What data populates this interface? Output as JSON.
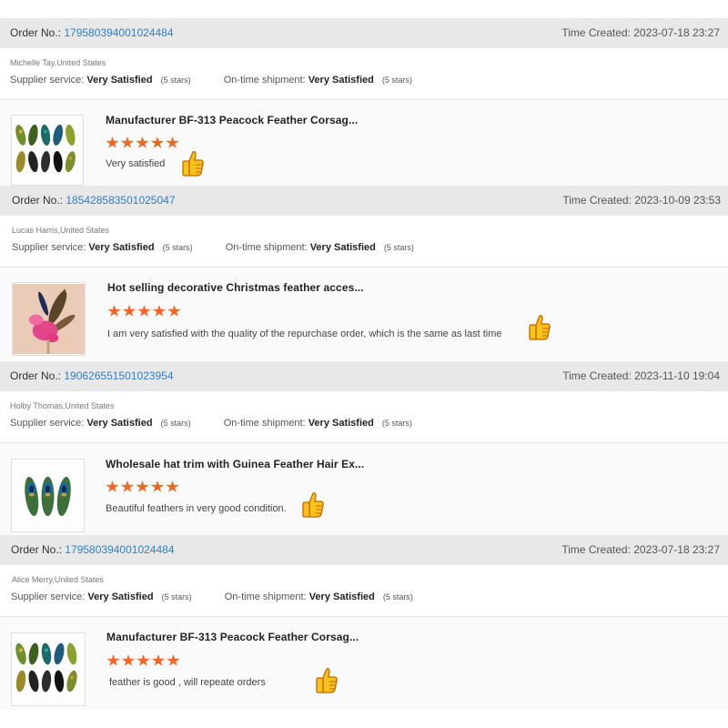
{
  "reviews": [
    {
      "order_label": "Order No.:",
      "order_no": "179580394001024484",
      "time_created": "Time Created: 2023-07-18 23:27",
      "buyer": "Michelle Tay,United States",
      "supplier_label": "Supplier service:",
      "supplier_value": "Very Satisfied",
      "supplier_stars": "(5 stars)",
      "shipment_label": "On-time shipment:",
      "shipment_value": "Very Satisfied",
      "shipment_stars": "(5 stars)",
      "product_title": "Manufacturer BF-313 Peacock Feather Corsag...",
      "rating": 5,
      "comment": "Very satisfied",
      "thumb_icon": "peacock-feather-set-image"
    },
    {
      "order_label": "Order No.:",
      "order_no": "185428583501025047",
      "time_created": "Time Created: 2023-10-09 23:53",
      "buyer": "Lucas Harris,United States",
      "supplier_label": "Supplier service:",
      "supplier_value": "Very Satisfied",
      "supplier_stars": "(5 stars)",
      "shipment_label": "On-time shipment:",
      "shipment_value": "Very Satisfied",
      "shipment_stars": "(5 stars)",
      "product_title": "Hot selling decorative Christmas feather acces...",
      "rating": 5,
      "comment": "I am very satisfied with the quality of the repurchase order, which is the same as last time",
      "thumb_icon": "pink-feather-image"
    },
    {
      "order_label": "Order No.:",
      "order_no": "190626551501023954",
      "time_created": "Time Created: 2023-11-10 19:04",
      "buyer": "Holby Thomas,United States",
      "supplier_label": "Supplier service:",
      "supplier_value": "Very Satisfied",
      "supplier_stars": "(5 stars)",
      "shipment_label": "On-time shipment:",
      "shipment_value": "Very Satisfied",
      "shipment_stars": "(5 stars)",
      "product_title": "Wholesale hat trim with Guinea Feather Hair Ex...",
      "rating": 5,
      "comment": "Beautiful feathers in very good condition.",
      "thumb_icon": "peacock-eye-feathers-image"
    },
    {
      "order_label": "Order No.:",
      "order_no": "179580394001024484",
      "time_created": "Time Created: 2023-07-18 23:27",
      "buyer": "Alice Merry,United States",
      "supplier_label": "Supplier service:",
      "supplier_value": "Very Satisfied",
      "supplier_stars": "(5 stars)",
      "shipment_label": "On-time shipment:",
      "shipment_value": "Very Satisfied",
      "shipment_stars": "(5 stars)",
      "product_title": "Manufacturer BF-313 Peacock Feather Corsag...",
      "rating": 5,
      "comment": "feather is good , will repeate orders",
      "thumb_icon": "peacock-feather-set-image"
    }
  ],
  "colors": {
    "order_link": "#2f7fc6",
    "star": "#f26522",
    "order_bar_bg": "#e8e8e8"
  }
}
